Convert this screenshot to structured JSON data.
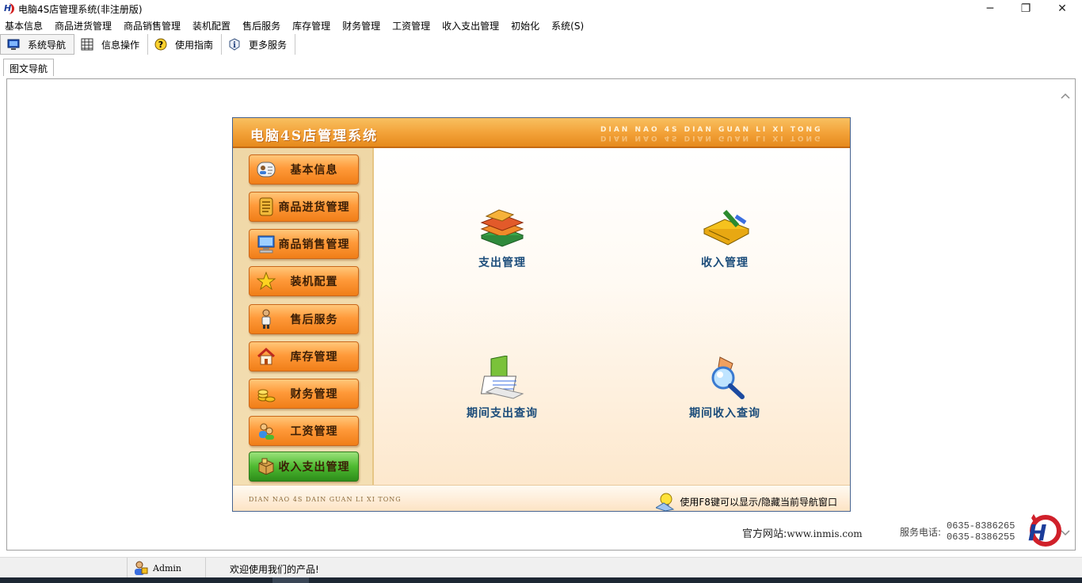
{
  "window": {
    "title": "电脑4S店管理系统(非注册版)",
    "minimize": "─",
    "restore": "❐",
    "close": "✕"
  },
  "menu": [
    "基本信息",
    "商品进货管理",
    "商品销售管理",
    "装机配置",
    "售后服务",
    "库存管理",
    "财务管理",
    "工资管理",
    "收入支出管理",
    "初始化",
    "系统(S)"
  ],
  "toolbar": [
    {
      "label": "系统导航",
      "icon": "monitor-icon",
      "active": true
    },
    {
      "label": "信息操作",
      "icon": "grid-icon",
      "active": false
    },
    {
      "label": "使用指南",
      "icon": "help-icon",
      "active": false
    },
    {
      "label": "更多服务",
      "icon": "info-icon",
      "active": false
    }
  ],
  "tab": {
    "label": "图文导航"
  },
  "panel": {
    "title": "电脑4S店管理系统",
    "pinyin": "DIAN NAO 4S DIAN GUAN LI XI TONG",
    "footer_pinyin": "DIAN NAO 4S DAIN GUAN LI XI TONG",
    "footer_tip": "使用F8键可以显示/隐藏当前导航窗口"
  },
  "nav": [
    {
      "label": "基本信息",
      "icon": "contact-card-icon"
    },
    {
      "label": "商品进货管理",
      "icon": "ledger-icon"
    },
    {
      "label": "商品销售管理",
      "icon": "computer-icon"
    },
    {
      "label": "装机配置",
      "icon": "star-icon"
    },
    {
      "label": "售后服务",
      "icon": "person-icon"
    },
    {
      "label": "库存管理",
      "icon": "house-icon"
    },
    {
      "label": "财务管理",
      "icon": "coins-icon"
    },
    {
      "label": "工资管理",
      "icon": "users-icon"
    },
    {
      "label": "收入支出管理",
      "icon": "box-icon",
      "selected": true
    }
  ],
  "features": [
    {
      "label": "支出管理",
      "icon": "books-icon"
    },
    {
      "label": "收入管理",
      "icon": "notebook-pen-icon"
    },
    {
      "label": "期间支出查询",
      "icon": "folder-docs-icon"
    },
    {
      "label": "期间收入查询",
      "icon": "magnifier-icon"
    }
  ],
  "info": {
    "site_label": "官方网站:",
    "site_value": "www.inmis.com",
    "phone_label": "服务电话:",
    "phone1": "0635-8386265",
    "phone2": "0635-8386255"
  },
  "status": {
    "user": "Admin",
    "message": "欢迎使用我们的产品!"
  }
}
